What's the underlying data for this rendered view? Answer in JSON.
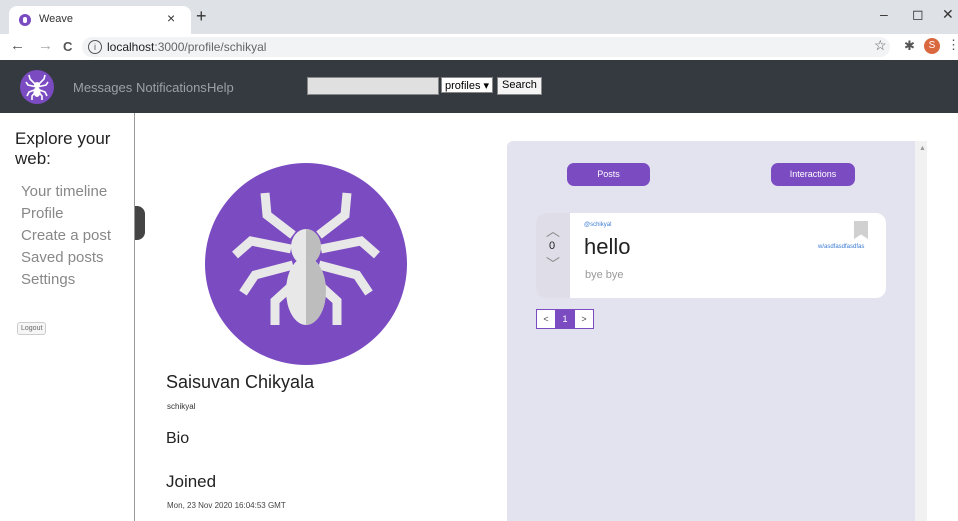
{
  "browser": {
    "tab_title": "Weave",
    "close_glyph": "×",
    "newtab_glyph": "+",
    "url_host": "localhost",
    "url_path": ":3000/profile/schikyal",
    "profile_initial": "S",
    "controls": {
      "back": "←",
      "forward": "→",
      "reload": "C",
      "info": "i",
      "star": "☆",
      "extensions": "✱",
      "menu": "⋮",
      "minimize": "–",
      "maximize": "◻",
      "close": "✕"
    }
  },
  "navbar": {
    "links": [
      "Messages",
      "Notifications",
      "Help"
    ],
    "search_value": "",
    "search_select": "profiles ▾",
    "search_button": "Search"
  },
  "sidebar": {
    "title": "Explore your web:",
    "items": [
      "Your timeline",
      "Profile",
      "Create a post",
      "Saved posts",
      "Settings"
    ],
    "logout": "Logout"
  },
  "profile": {
    "name": "Saisuvan Chikyala",
    "username": "schikyal",
    "bio_heading": "Bio",
    "joined_heading": "Joined",
    "joined_date": "Mon, 23 Nov 2020 16:04:53 GMT"
  },
  "panel": {
    "tabs": [
      "Posts",
      "Interactions"
    ],
    "post": {
      "author": "@schikyal",
      "title": "hello",
      "body": "bye bye",
      "tag": "w/asdfasdfasdfas",
      "votes": "0",
      "up_glyph": "︿",
      "down_glyph": "﹀"
    },
    "pager": {
      "prev": "<",
      "current": "1",
      "next": ">"
    }
  },
  "colors": {
    "brand": "#7b4bc2",
    "navbar": "#343a40",
    "panel": "#e3e2ef"
  }
}
